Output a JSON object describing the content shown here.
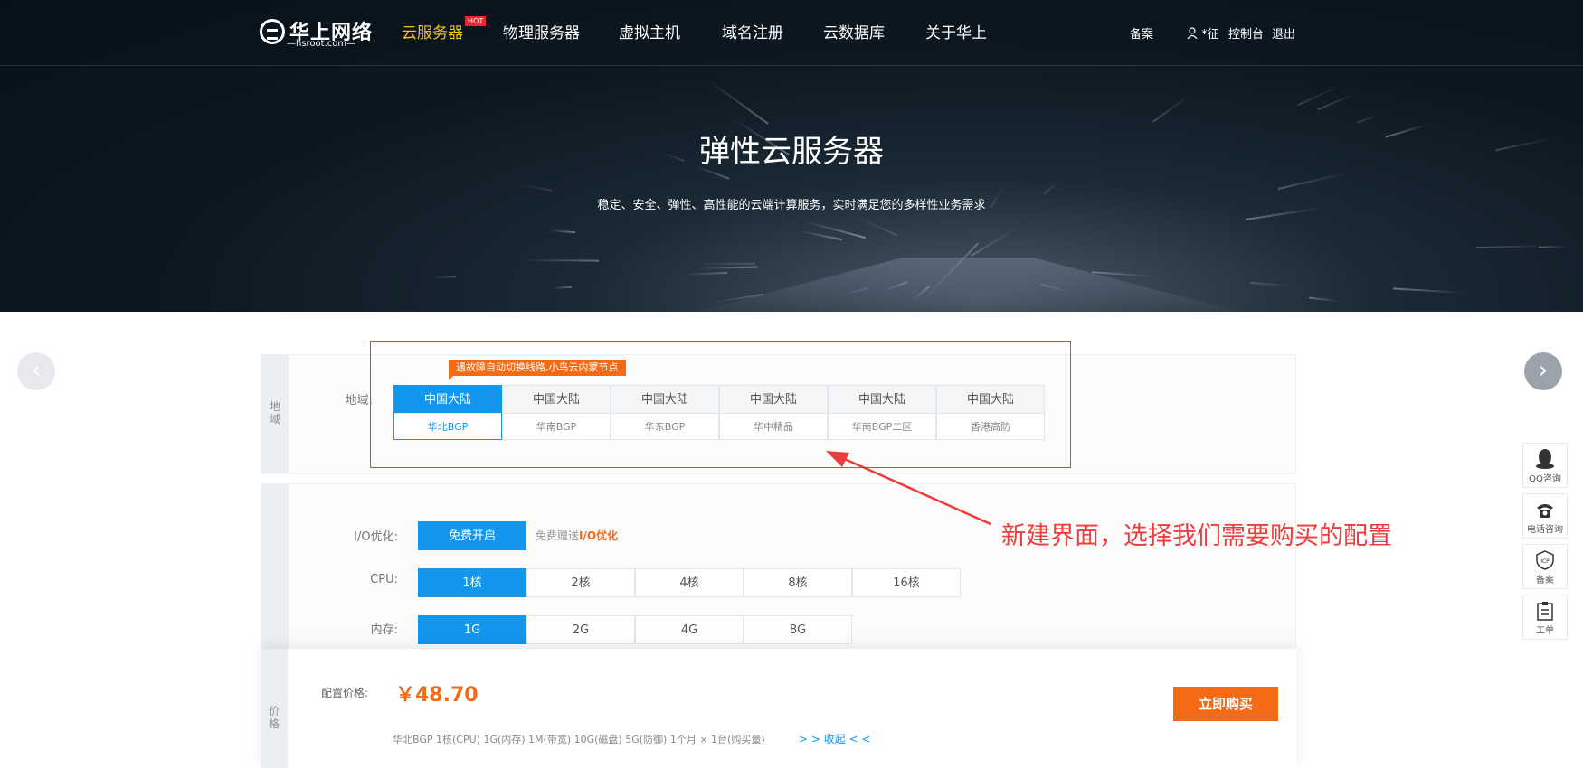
{
  "header": {
    "logo_cn": "华上网络",
    "logo_en": "—hsroot.com—",
    "nav": [
      {
        "label": "云服务器",
        "active": true,
        "badge": "HOT"
      },
      {
        "label": "物理服务器"
      },
      {
        "label": "虚拟主机"
      },
      {
        "label": "域名注册"
      },
      {
        "label": "云数据库"
      },
      {
        "label": "关于华上"
      }
    ],
    "beian": "备案",
    "user": "*征",
    "console": "控制台",
    "logout": "退出"
  },
  "hero": {
    "title": "弹性云服务器",
    "subtitle": "稳定、安全、弹性、高性能的云端计算服务，实时满足您的多样性业务需求"
  },
  "region_panel": {
    "side_label": "地域",
    "field_label": "地域:",
    "promo_badge": "遇故障自动切换线路,小鸟云内蒙节点",
    "regions": [
      {
        "top": "中国大陆",
        "bottom": "华北BGP",
        "selected": true
      },
      {
        "top": "中国大陆",
        "bottom": "华南BGP"
      },
      {
        "top": "中国大陆",
        "bottom": "华东BGP"
      },
      {
        "top": "中国大陆",
        "bottom": "华中精品"
      },
      {
        "top": "中国大陆",
        "bottom": "华南BGP二区"
      },
      {
        "top": "中国大陆",
        "bottom": "香港高防"
      }
    ]
  },
  "config_panel": {
    "io_label": "I/O优化:",
    "io_button": "免费开启",
    "io_note_prefix": "免费赠送",
    "io_note_highlight": "I/O优化",
    "cpu_label": "CPU:",
    "cpu_options": [
      "1核",
      "2核",
      "4核",
      "8核",
      "16核"
    ],
    "cpu_selected": "1核",
    "mem_label": "内存:",
    "mem_options": [
      "1G",
      "2G",
      "4G",
      "8G"
    ],
    "mem_selected": "1G"
  },
  "annotation": {
    "note": "新建界面，选择我们需要购买的配置",
    "color": "#ee3b3b"
  },
  "price_bar": {
    "side_label": "价格",
    "price_label": "配置价格:",
    "price": "￥48.70",
    "summary": "华北BGP  1核(CPU)  1G(内存)  1M(带宽)  10G(磁盘)  5G(防御)  1个月 × 1台(购买量)",
    "collapse": "> > 收起 < <",
    "buy_button": "立即购买"
  },
  "float_tools": [
    {
      "icon": "qq-icon",
      "label": "QQ咨询"
    },
    {
      "icon": "phone-icon",
      "label": "电话咨询"
    },
    {
      "icon": "icp-icon",
      "label": "备案"
    },
    {
      "icon": "clipboard-icon",
      "label": "工单"
    }
  ],
  "colors": {
    "accent": "#1296ee",
    "orange": "#f56a14",
    "nav_active": "#f5c518"
  }
}
